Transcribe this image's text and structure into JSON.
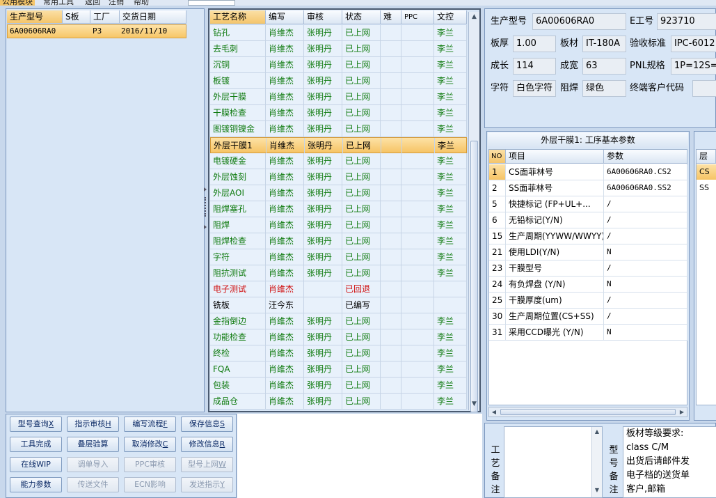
{
  "menu": [
    "公用模块",
    "常用工具",
    "返回",
    "注销",
    "帮助"
  ],
  "left_grid": {
    "headers": [
      "生产型号",
      "S板",
      "工厂",
      "交货日期"
    ],
    "row": {
      "model": "6A00606RA0",
      "s_board": "",
      "factory": "P3",
      "date": "2016/11/10"
    }
  },
  "process_grid": {
    "headers": [
      "工艺名称",
      "编写",
      "审核",
      "状态",
      "难",
      "PPC",
      "文控"
    ],
    "rows": [
      {
        "name": "钻孔",
        "writer": "肖维杰",
        "reviewer": "张明丹",
        "status": "已上网",
        "hard": "",
        "ppc": "",
        "doc": "李兰",
        "color": "green"
      },
      {
        "name": "去毛刺",
        "writer": "肖维杰",
        "reviewer": "张明丹",
        "status": "已上网",
        "hard": "",
        "ppc": "",
        "doc": "李兰",
        "color": "green"
      },
      {
        "name": "沉铜",
        "writer": "肖维杰",
        "reviewer": "张明丹",
        "status": "已上网",
        "hard": "",
        "ppc": "",
        "doc": "李兰",
        "color": "green"
      },
      {
        "name": "板镀",
        "writer": "肖维杰",
        "reviewer": "张明丹",
        "status": "已上网",
        "hard": "",
        "ppc": "",
        "doc": "李兰",
        "color": "green"
      },
      {
        "name": "外层干膜",
        "writer": "肖维杰",
        "reviewer": "张明丹",
        "status": "已上网",
        "hard": "",
        "ppc": "",
        "doc": "李兰",
        "color": "green"
      },
      {
        "name": "干膜检查",
        "writer": "肖维杰",
        "reviewer": "张明丹",
        "status": "已上网",
        "hard": "",
        "ppc": "",
        "doc": "李兰",
        "color": "green"
      },
      {
        "name": "图镀铜镍金",
        "writer": "肖维杰",
        "reviewer": "张明丹",
        "status": "已上网",
        "hard": "",
        "ppc": "",
        "doc": "李兰",
        "color": "green"
      },
      {
        "name": "外层干膜1",
        "writer": "肖维杰",
        "reviewer": "张明丹",
        "status": "已上网",
        "hard": "",
        "ppc": "",
        "doc": "李兰",
        "color": "selected"
      },
      {
        "name": "电镀硬金",
        "writer": "肖维杰",
        "reviewer": "张明丹",
        "status": "已上网",
        "hard": "",
        "ppc": "",
        "doc": "李兰",
        "color": "green"
      },
      {
        "name": "外层蚀刻",
        "writer": "肖维杰",
        "reviewer": "张明丹",
        "status": "已上网",
        "hard": "",
        "ppc": "",
        "doc": "李兰",
        "color": "green"
      },
      {
        "name": "外层AOI",
        "writer": "肖维杰",
        "reviewer": "张明丹",
        "status": "已上网",
        "hard": "",
        "ppc": "",
        "doc": "李兰",
        "color": "green"
      },
      {
        "name": "阻焊塞孔",
        "writer": "肖维杰",
        "reviewer": "张明丹",
        "status": "已上网",
        "hard": "",
        "ppc": "",
        "doc": "李兰",
        "color": "green"
      },
      {
        "name": "阻焊",
        "writer": "肖维杰",
        "reviewer": "张明丹",
        "status": "已上网",
        "hard": "",
        "ppc": "",
        "doc": "李兰",
        "color": "green"
      },
      {
        "name": "阻焊检查",
        "writer": "肖维杰",
        "reviewer": "张明丹",
        "status": "已上网",
        "hard": "",
        "ppc": "",
        "doc": "李兰",
        "color": "green"
      },
      {
        "name": "字符",
        "writer": "肖维杰",
        "reviewer": "张明丹",
        "status": "已上网",
        "hard": "",
        "ppc": "",
        "doc": "李兰",
        "color": "green"
      },
      {
        "name": "阻抗测试",
        "writer": "肖维杰",
        "reviewer": "张明丹",
        "status": "已上网",
        "hard": "",
        "ppc": "",
        "doc": "李兰",
        "color": "green"
      },
      {
        "name": "电子测试",
        "writer": "肖维杰",
        "reviewer": "",
        "status": "已回退",
        "hard": "",
        "ppc": "",
        "doc": "",
        "color": "red"
      },
      {
        "name": "铣板",
        "writer": "汪今东",
        "reviewer": "",
        "status": "已编写",
        "hard": "",
        "ppc": "",
        "doc": "",
        "color": "black"
      },
      {
        "name": "金指倒边",
        "writer": "肖维杰",
        "reviewer": "张明丹",
        "status": "已上网",
        "hard": "",
        "ppc": "",
        "doc": "李兰",
        "color": "green"
      },
      {
        "name": "功能检查",
        "writer": "肖维杰",
        "reviewer": "张明丹",
        "status": "已上网",
        "hard": "",
        "ppc": "",
        "doc": "李兰",
        "color": "green"
      },
      {
        "name": "终检",
        "writer": "肖维杰",
        "reviewer": "张明丹",
        "status": "已上网",
        "hard": "",
        "ppc": "",
        "doc": "李兰",
        "color": "green"
      },
      {
        "name": "FQA",
        "writer": "肖维杰",
        "reviewer": "张明丹",
        "status": "已上网",
        "hard": "",
        "ppc": "",
        "doc": "李兰",
        "color": "green"
      },
      {
        "name": "包装",
        "writer": "肖维杰",
        "reviewer": "张明丹",
        "status": "已上网",
        "hard": "",
        "ppc": "",
        "doc": "李兰",
        "color": "green"
      },
      {
        "name": "成品仓",
        "writer": "肖维杰",
        "reviewer": "张明丹",
        "status": "已上网",
        "hard": "",
        "ppc": "",
        "doc": "李兰",
        "color": "green"
      }
    ]
  },
  "buttons": [
    {
      "label": "型号查询",
      "key": "X",
      "enabled": true
    },
    {
      "label": "指示审核",
      "key": "H",
      "enabled": true
    },
    {
      "label": "编写流程",
      "key": "F",
      "enabled": true
    },
    {
      "label": "保存信息",
      "key": "S",
      "enabled": true
    },
    {
      "label": "工具完成",
      "key": "",
      "enabled": true
    },
    {
      "label": "叠层验算",
      "key": "",
      "enabled": true
    },
    {
      "label": "取消修改",
      "key": "C",
      "enabled": true
    },
    {
      "label": "修改信息",
      "key": "R",
      "enabled": true
    },
    {
      "label": "在线WIP",
      "key": "",
      "enabled": true
    },
    {
      "label": "调单导入",
      "key": "",
      "enabled": false
    },
    {
      "label": "PPC审核",
      "key": "",
      "enabled": false
    },
    {
      "label": "型号上网",
      "key": "W",
      "enabled": false
    },
    {
      "label": "能力参数",
      "key": "",
      "enabled": true
    },
    {
      "label": "传送文件",
      "key": "",
      "enabled": false
    },
    {
      "label": "ECN影响",
      "key": "",
      "enabled": false
    },
    {
      "label": "发送指示",
      "key": "Y",
      "enabled": false
    }
  ],
  "info": {
    "model_label": "生产型号",
    "model": "6A00606RA0",
    "e_label": "E工号",
    "e_no": "923710",
    "thick_label": "板厚",
    "thick": "1.00",
    "material_label": "板材",
    "material": "IT-180A",
    "std_label": "验收标准",
    "std": "IPC-6012",
    "length_label": "成长",
    "length": "114",
    "width_label": "成宽",
    "width": "63",
    "pnl_label": "PNL规格",
    "pnl": "1P=12S=",
    "char_label": "字符",
    "char": "白色字符",
    "mask_label": "阻焊",
    "mask": "绿色",
    "customer_label": "终端客户代码",
    "customer": ""
  },
  "params": {
    "title": "外层干膜1: 工序基本参数",
    "headers": [
      "NO",
      "项目",
      "参数"
    ],
    "rows": [
      {
        "no": "1",
        "item": "CS面菲林号",
        "value": "6A00606RA0.CS2"
      },
      {
        "no": "2",
        "item": "SS面菲林号",
        "value": "6A00606RA0.SS2"
      },
      {
        "no": "5",
        "item": "快捷标记 (FP+UL+...",
        "value": "/"
      },
      {
        "no": "6",
        "item": "无铅标记(Y/N)",
        "value": "/"
      },
      {
        "no": "15",
        "item": "生产周期(YYWW/WWYY)",
        "value": "/"
      },
      {
        "no": "21",
        "item": "使用LDI(Y/N)",
        "value": "N"
      },
      {
        "no": "23",
        "item": "干膜型号",
        "value": "/"
      },
      {
        "no": "24",
        "item": "有负焊盘 (Y/N)",
        "value": "N"
      },
      {
        "no": "25",
        "item": "干膜厚度(um)",
        "value": "/"
      },
      {
        "no": "30",
        "item": "生产周期位置(CS+SS)",
        "value": "/"
      },
      {
        "no": "31",
        "item": "采用CCD曝光 (Y/N)",
        "value": "N"
      }
    ]
  },
  "layers": {
    "header": "层",
    "rows": [
      "CS",
      "SS"
    ]
  },
  "notes": {
    "process_note_label": [
      "工",
      "艺",
      "备",
      "注"
    ],
    "model_note_label": [
      "型",
      "号",
      "备",
      "注"
    ],
    "model_note_lines": [
      "板材等级要求:",
      "class C/M",
      "出货后请邮件发",
      "电子档的送货单",
      "客户,邮箱"
    ]
  }
}
